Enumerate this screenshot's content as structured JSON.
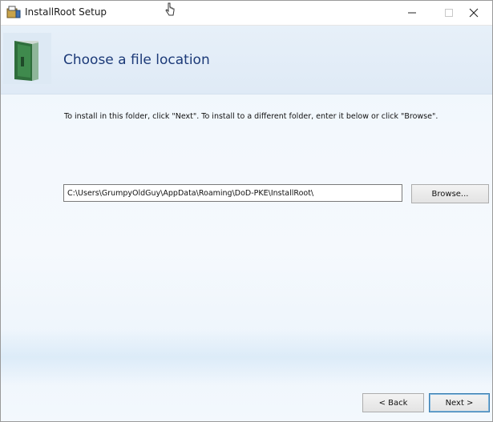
{
  "window": {
    "title": "InstallRoot Setup",
    "controls": {
      "minimize_icon": "minimize-icon",
      "maximize_icon": "maximize-icon",
      "close_icon": "close-icon"
    }
  },
  "header": {
    "title": "Choose a file location",
    "icon": "folder-icon"
  },
  "instruction": "To install in this folder, click \"Next\". To install to a different folder, enter it below or click \"Browse\".",
  "install_path": {
    "value": "C:\\Users\\GrumpyOldGuy\\AppData\\Roaming\\DoD-PKE\\InstallRoot\\"
  },
  "buttons": {
    "browse": "Browse...",
    "back": "< Back",
    "next": "Next >"
  },
  "colors": {
    "header_title": "#1c3a78",
    "accent_border": "#3c7fb1",
    "background": "#eef5fc"
  }
}
